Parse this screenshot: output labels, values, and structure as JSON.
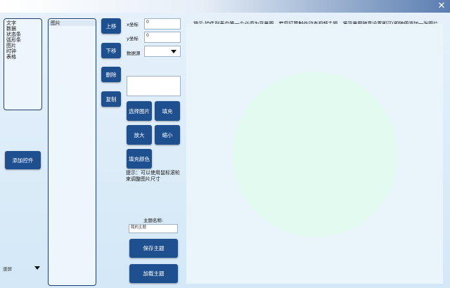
{
  "window": {
    "close_glyph": "✕"
  },
  "control_types": [
    "文字",
    "数据",
    "状态条",
    "弧形条",
    "图片",
    "时钟",
    "表格"
  ],
  "control_list": [
    "图片"
  ],
  "buttons": {
    "add_control": "添加控件",
    "move_up": "上移",
    "move_down": "下移",
    "delete": "删除",
    "copy": "复制",
    "select_image": "选择图片",
    "fill": "填充",
    "zoom_in": "放大",
    "zoom_out": "缩小",
    "fill_color": "填充颜色",
    "save_theme": "保存主题",
    "load_theme": "加载主题"
  },
  "fields": {
    "x_label": "x坐标",
    "x_value": "0",
    "y_label": "y坐标",
    "y_value": "0",
    "data_source_label": "数据源",
    "theme_name_label": "主题名称:",
    "theme_name_value": "我的主题"
  },
  "orientation_select": {
    "value": "竖屏"
  },
  "tips": {
    "scroll_hint": "提示：可以使用鼠标滚轮来调整图片尺寸",
    "top_hint": "提示:控件列表中第一个必须为背景图，若您打算制作动态视频主题，将背景图随意设置即可(即随便添加一张图片做背景图)，后续在主界面中设置动态视频后会自动替换"
  },
  "icons": {
    "close": "close-icon",
    "dropdown": "chevron-down-icon"
  }
}
